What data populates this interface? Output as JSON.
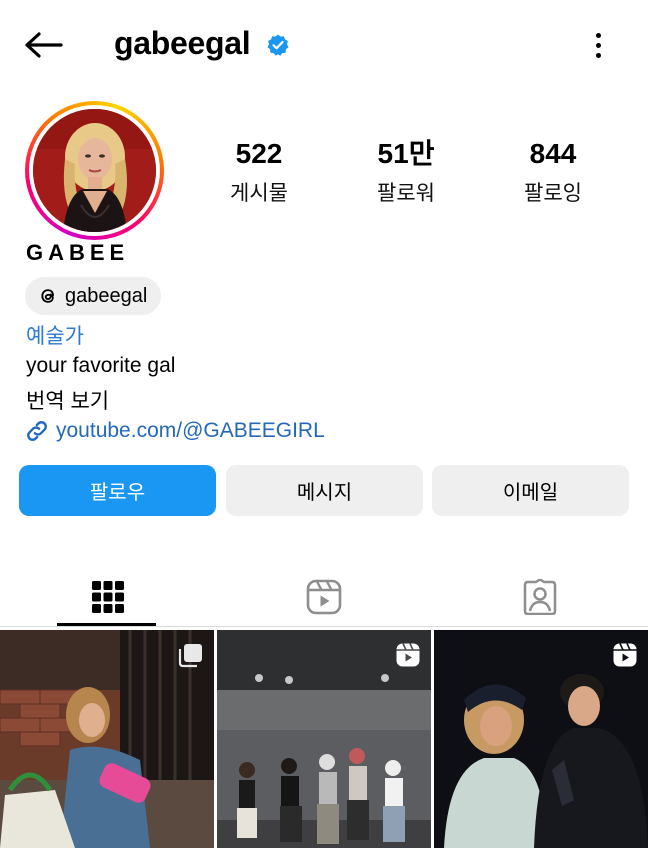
{
  "header": {
    "username": "gabeegal",
    "icons": {
      "back": "arrow-left-icon",
      "verified": "verified-badge-icon",
      "more": "more-vertical-icon"
    }
  },
  "stats": [
    {
      "value": "522",
      "label": "게시물"
    },
    {
      "value": "51만",
      "label": "팔로워"
    },
    {
      "value": "844",
      "label": "팔로잉"
    }
  ],
  "profile": {
    "display_name": "GABEE",
    "threads_handle": "gabeegal",
    "category": "예술가",
    "bio": "your favorite gal",
    "translate": "번역 보기",
    "link": "youtube.com/@GABEEGIRL"
  },
  "actions": {
    "follow": "팔로우",
    "message": "메시지",
    "email": "이메일"
  },
  "tabs": [
    {
      "icon": "grid-icon",
      "active": true
    },
    {
      "icon": "reels-icon",
      "active": false
    },
    {
      "icon": "tagged-icon",
      "active": false
    }
  ],
  "colors": {
    "primary_button": "#1a97f2",
    "verified": "#1a97f2",
    "category_text": "#2b7bd1",
    "link_text": "#2469b9",
    "secondary_button": "#efefef"
  },
  "posts": [
    {
      "type": "carousel",
      "badge_icon": "carousel-icon"
    },
    {
      "type": "reel",
      "badge_icon": "reels-icon"
    },
    {
      "type": "reel",
      "badge_icon": "reels-icon"
    }
  ]
}
